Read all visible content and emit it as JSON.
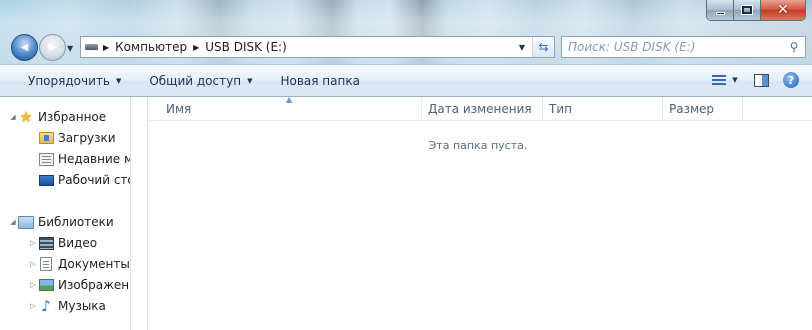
{
  "window": {
    "controls": {
      "minimize_icon": "minimize-icon",
      "maximize_icon": "maximize-icon",
      "close_icon": "close-icon",
      "close_glyph": "✕"
    }
  },
  "navigation": {
    "back_icon": "back-arrow-icon",
    "forward_icon": "forward-arrow-icon",
    "back_glyph": "◀",
    "forward_glyph": "▶",
    "dropdown_glyph": "▼"
  },
  "address_bar": {
    "crumbs": [
      "Компьютер",
      "USB DISK (E:)"
    ],
    "separator_glyph": "▶",
    "dropdown_glyph": "▼",
    "refresh_glyph": "⇆"
  },
  "search": {
    "placeholder": "Поиск: USB DISK (E:)",
    "icon_glyph": "⚲"
  },
  "toolbar": {
    "organize_label": "Упорядочить",
    "share_label": "Общий доступ",
    "new_folder_label": "Новая папка",
    "arrow_glyph": "▼",
    "help_glyph": "?"
  },
  "sidebar": {
    "favorites_label": "Избранное",
    "favorites_items": [
      "Загрузки",
      "Недавние места",
      "Рабочий стол"
    ],
    "libraries_label": "Библиотеки",
    "libraries_items": [
      "Видео",
      "Документы",
      "Изображения",
      "Музыка"
    ],
    "expand_glyph": "▷",
    "expanded_glyph": "◢",
    "star_glyph": "★",
    "music_glyph": "♪"
  },
  "columns": {
    "name": "Имя",
    "date_modified": "Дата изменения",
    "type": "Тип",
    "size": "Размер",
    "sort_glyph": "▲"
  },
  "empty_message": "Эта папка пуста.",
  "colors": {
    "toolbar_text": "#1e3150",
    "header_text": "#4c607a",
    "accent": "#3b6db5"
  }
}
